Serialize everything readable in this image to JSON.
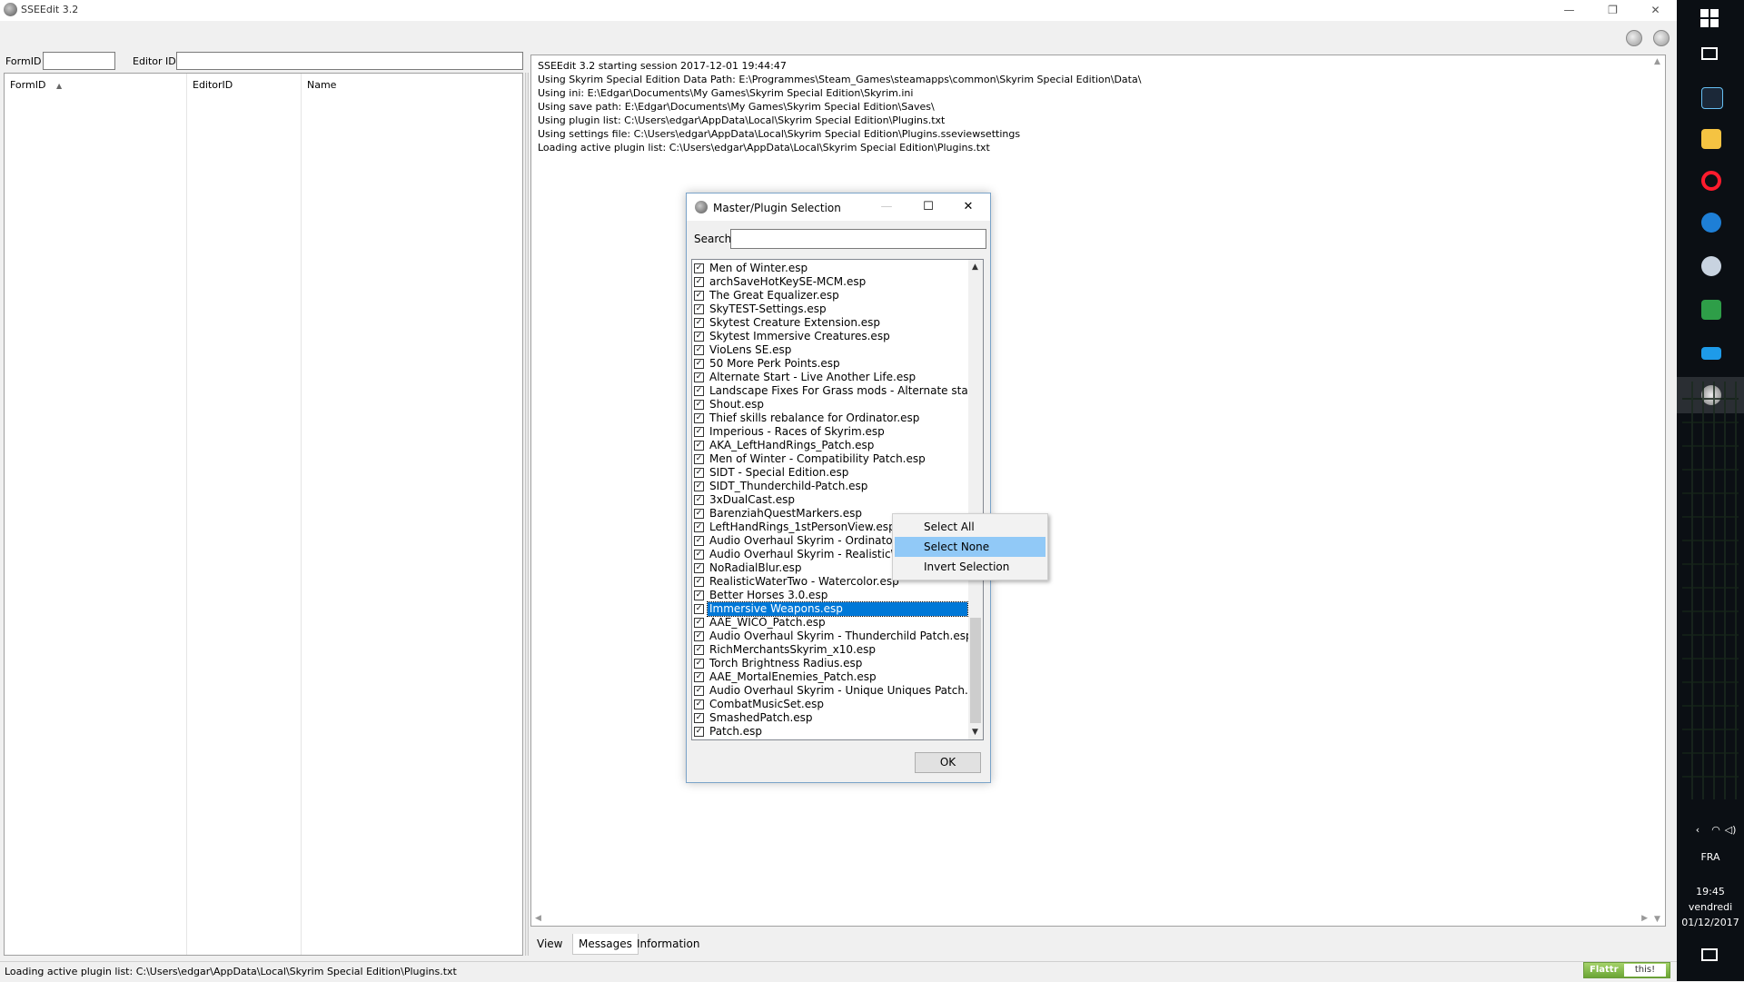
{
  "window": {
    "title": "SSEEdit 3.2",
    "minimize": "—",
    "restore": "❐",
    "close": "✕"
  },
  "filter": {
    "formid_label": "FormID",
    "editorid_label": "Editor ID",
    "formid_value": "",
    "editorid_value": ""
  },
  "tree": {
    "columns": [
      "FormID",
      "EditorID",
      "Name"
    ],
    "sort_indicator": "▲"
  },
  "log": {
    "lines": [
      "SSEEdit 3.2 starting session 2017-12-01 19:44:47",
      "Using Skyrim Special Edition Data Path: E:\\Programmes\\Steam_Games\\steamapps\\common\\Skyrim Special Edition\\Data\\",
      "Using ini: E:\\Edgar\\Documents\\My Games\\Skyrim Special Edition\\Skyrim.ini",
      "Using save path: E:\\Edgar\\Documents\\My Games\\Skyrim Special Edition\\Saves\\",
      "Using plugin list: C:\\Users\\edgar\\AppData\\Local\\Skyrim Special Edition\\Plugins.txt",
      "Using settings file: C:\\Users\\edgar\\AppData\\Local\\Skyrim Special Edition\\Plugins.sseviewsettings",
      "Loading active plugin list: C:\\Users\\edgar\\AppData\\Local\\Skyrim Special Edition\\Plugins.txt"
    ]
  },
  "tabs": [
    "View",
    "Messages",
    "Information"
  ],
  "active_tab": "Messages",
  "status": {
    "text": "Loading active plugin list: C:\\Users\\edgar\\AppData\\Local\\Skyrim Special Edition\\Plugins.txt",
    "flattr_a": "Flattr",
    "flattr_b": "this!"
  },
  "dialog": {
    "title": "Master/Plugin Selection",
    "search_label": "Search",
    "search_value": "",
    "ok_label": "OK",
    "plugins": [
      "Men of Winter.esp",
      "archSaveHotKeySE-MCM.esp",
      "The Great Equalizer.esp",
      "SkyTEST-Settings.esp",
      "Skytest Creature Extension.esp",
      "Skytest Immersive Creatures.esp",
      "VioLens SE.esp",
      "50 More Perk Points.esp",
      "Alternate Start - Live Another Life.esp",
      "Landscape Fixes For Grass mods - Alternate start Locati",
      "Shout.esp",
      "Thief skills rebalance for Ordinator.esp",
      "Imperious - Races of Skyrim.esp",
      "AKA_LeftHandRings_Patch.esp",
      "Men of Winter - Compatibility Patch.esp",
      "SIDT - Special Edition.esp",
      "SIDT_Thunderchild-Patch.esp",
      "3xDualCast.esp",
      "BarenziahQuestMarkers.esp",
      "LeftHandRings_1stPersonView.esp",
      "Audio Overhaul Skyrim - Ordinator Pat",
      "Audio Overhaul Skyrim - RealisticWate",
      "NoRadialBlur.esp",
      "RealisticWaterTwo - Watercolor.esp",
      "Better Horses 3.0.esp",
      "Immersive Weapons.esp",
      "AAE_WICO_Patch.esp",
      "Audio Overhaul Skyrim - Thunderchild Patch.esp",
      "RichMerchantsSkyrim_x10.esp",
      "Torch Brightness Radius.esp",
      "AAE_MortalEnemies_Patch.esp",
      "Audio Overhaul Skyrim - Unique Uniques Patch.esp",
      "CombatMusicSet.esp",
      "SmashedPatch.esp",
      "Patch.esp"
    ],
    "selected_plugin": "Immersive Weapons.esp",
    "check_glyph": "✓"
  },
  "context_menu": {
    "items": [
      "Select All",
      "Select None",
      "Invert Selection"
    ],
    "highlighted": "Select None"
  },
  "taskbar": {
    "lang": "FRA",
    "time": "19:45",
    "day": "vendredi",
    "date": "01/12/2017"
  },
  "colors": {
    "selection": "#0078d7",
    "menu_highlight": "#91c9f7",
    "taskbar": "#0b0f14",
    "flattr": "#6aa534"
  }
}
